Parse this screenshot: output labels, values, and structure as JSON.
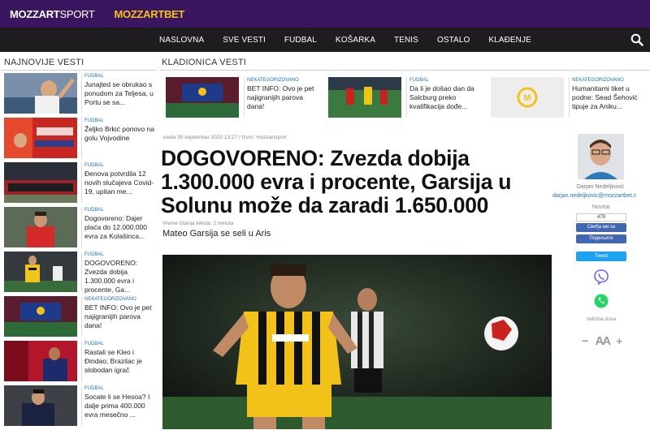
{
  "brands": {
    "sport_a": "MOZZART",
    "sport_b": "SPORT",
    "bet": "MOZZARTBET"
  },
  "nav": [
    "NASLOVNA",
    "SVE VESTI",
    "FUDBAL",
    "KOŠARKA",
    "TENIS",
    "OSTALO",
    "KLAĐENJE"
  ],
  "left": {
    "title": "NAJNOVIJE VESTI",
    "items": [
      {
        "tag": "FUDBAL",
        "title": "Junajted se obrukao s ponudom za Teljesa, u Portu se sa..."
      },
      {
        "tag": "FUDBAL",
        "title": "Željko Brkić ponovo na golu Vojvodine"
      },
      {
        "tag": "FUDBAL",
        "title": "Đenova potvrdila 12 novih slučajeva Covid-19, upitan me..."
      },
      {
        "tag": "FUDBAL",
        "title": "Dogovoreno: Dajer plaća do 12.000.000 evra za Kolašinca..."
      },
      {
        "tag": "FUDBAL",
        "title": "DOGOVORENO: Zvezda dobija 1.300.000 evra i procente, Ga..."
      },
      {
        "tag": "NEKATEGORIZOVANO",
        "title": "BET INFO: Ovo je pet najigranijih parova dana!"
      },
      {
        "tag": "FUDBAL",
        "title": "Rastali se Kleo i Đindao, Brazilac je slobodan igrač"
      },
      {
        "tag": "FUDBAL",
        "title": "Socate li se Hesoa? I dalje prima 400.000 evra mesečno ..."
      }
    ]
  },
  "kladionica": {
    "title": "KLADIONICA VESTI",
    "items": [
      {
        "tag": "NEKATEGORIZOVANO",
        "title": "BET INFO: Ovo je pet najigranijih parova dana!"
      },
      {
        "tag": "FUDBAL",
        "title": "Da li je došao dan da Salcburg preko kvalifikacija dođe..."
      },
      {
        "tag": "NEKATEGORIZOVANO",
        "title": "Humanitarni tiket u podne: Sead Šehović tipuje za Aniku..."
      }
    ]
  },
  "article": {
    "meta": "sreda 30 septembar 2020 13:27 / Izvor: mozzartsport",
    "headline": "DOGOVORENO: Zvezda dobija 1.300.000 evra i procente, Garsija u Solunu može da zaradi 1.650.000",
    "readtime": "Vreme čitanja teksta: 2 minuta",
    "lead": "Mateo Garsija se seli u Aris"
  },
  "author": {
    "name": "Darjan Nedeljković",
    "email": "darjan.nedeljkovic@mozzartbet.c",
    "role": "Novitar"
  },
  "social": {
    "count": "479",
    "like": "Свиђа ми се",
    "share": "Подељите",
    "tweet": "Tweet"
  },
  "font_size": {
    "label": "Veličina slova",
    "minus": "−",
    "aa": "AA",
    "plus": "+"
  },
  "colors": {
    "topbar": "#3a1560",
    "nav": "#1d1d1f",
    "accent_yellow": "#f6c21a",
    "link_blue": "#1f6fb4"
  }
}
